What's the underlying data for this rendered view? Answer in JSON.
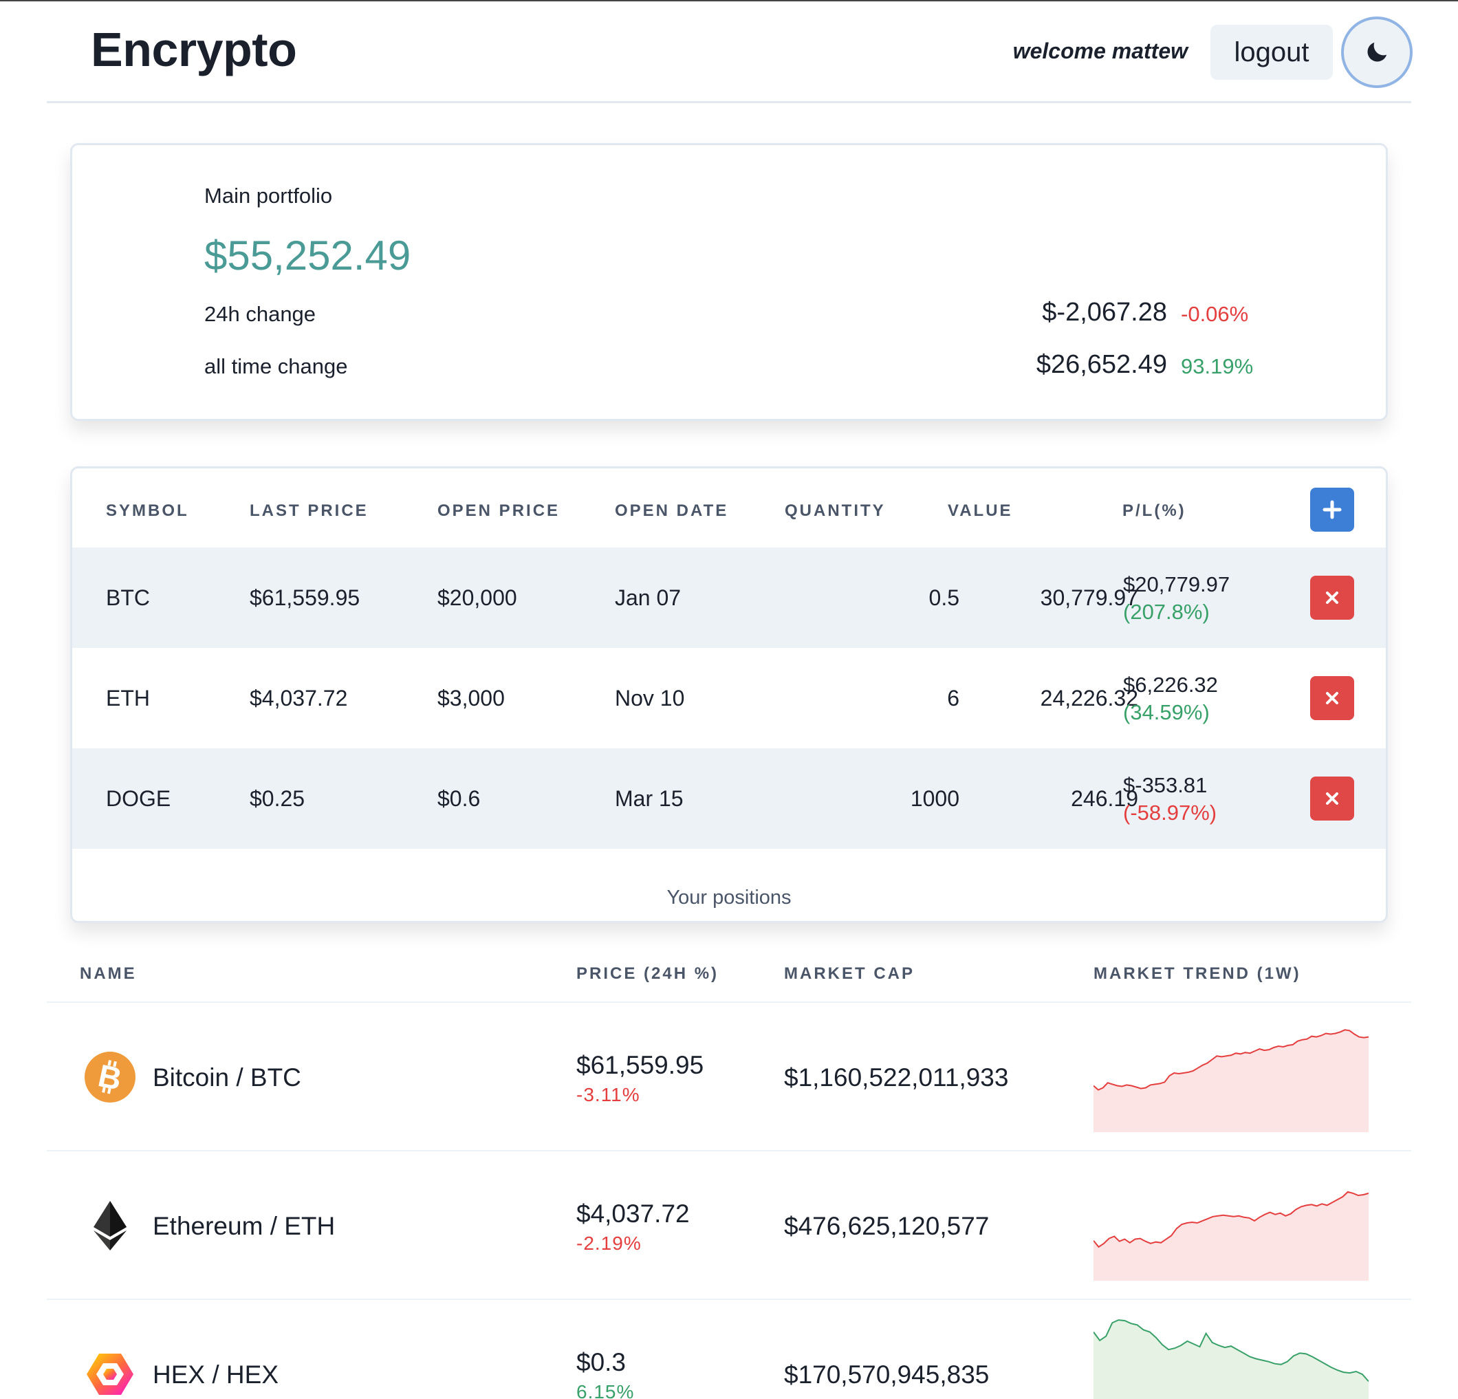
{
  "header": {
    "brand": "Encrypto",
    "welcome": "welcome mattew",
    "logout_label": "logout",
    "theme_icon": "moon-icon"
  },
  "portfolio": {
    "title": "Main portfolio",
    "total": "$55,252.49",
    "change_24h": {
      "label": "24h change",
      "amount": "$-2,067.28",
      "percent": "-0.06%",
      "direction": "down"
    },
    "change_all": {
      "label": "all time change",
      "amount": "$26,652.49",
      "percent": "93.19%",
      "direction": "up"
    }
  },
  "positions": {
    "columns": [
      "SYMBOL",
      "LAST PRICE",
      "OPEN PRICE",
      "OPEN DATE",
      "QUANTITY",
      "VALUE",
      "P/L(%)"
    ],
    "add_icon": "plus-icon",
    "delete_icon": "close-icon",
    "rows": [
      {
        "symbol": "BTC",
        "last_price": "$61,559.95",
        "open_price": "$20,000",
        "open_date": "Jan 07",
        "quantity": "0.5",
        "value": "30,779.97",
        "pl_amount": "$20,779.97",
        "pl_percent": "(207.8%)",
        "direction": "up"
      },
      {
        "symbol": "ETH",
        "last_price": "$4,037.72",
        "open_price": "$3,000",
        "open_date": "Nov 10",
        "quantity": "6",
        "value": "24,226.32",
        "pl_amount": "$6,226.32",
        "pl_percent": "(34.59%)",
        "direction": "up"
      },
      {
        "symbol": "DOGE",
        "last_price": "$0.25",
        "open_price": "$0.6",
        "open_date": "Mar 15",
        "quantity": "1000",
        "value": "246.19",
        "pl_amount": "$-353.81",
        "pl_percent": "(-58.97%)",
        "direction": "down"
      }
    ],
    "caption": "Your positions"
  },
  "market": {
    "columns": [
      "NAME",
      "PRICE (24H %)",
      "MARKET CAP",
      "MARKET TREND (1W)"
    ],
    "rows": [
      {
        "name": "Bitcoin / BTC",
        "icon": "bitcoin-icon",
        "price": "$61,559.95",
        "change": "-3.11%",
        "direction": "down",
        "market_cap": "$1,160,522,011,933",
        "trend": [
          58,
          52,
          55,
          62,
          60,
          58,
          57,
          59,
          58,
          56,
          54,
          55,
          59,
          60,
          61,
          63,
          72,
          76,
          75,
          76,
          77,
          79,
          83,
          87,
          90,
          95,
          100,
          99,
          100,
          101,
          104,
          103,
          105,
          104,
          107,
          110,
          108,
          109,
          112,
          114,
          113,
          115,
          116,
          121,
          123,
          124,
          128,
          127,
          129,
          132,
          131,
          132,
          134,
          137,
          136,
          131,
          127,
          126,
          127
        ]
      },
      {
        "name": "Ethereum / ETH",
        "icon": "ethereum-icon",
        "price": "$4,037.72",
        "change": "-2.19%",
        "direction": "down",
        "market_cap": "$476,625,120,577",
        "trend": [
          49,
          40,
          45,
          52,
          55,
          48,
          51,
          46,
          51,
          52,
          48,
          45,
          47,
          46,
          51,
          56,
          66,
          72,
          74,
          75,
          74,
          77,
          80,
          83,
          84,
          85,
          84,
          83,
          84,
          82,
          81,
          77,
          82,
          86,
          89,
          86,
          88,
          84,
          87,
          93,
          97,
          99,
          100,
          98,
          101,
          99,
          103,
          107,
          111,
          118,
          116,
          113,
          114,
          116
        ]
      },
      {
        "name": "HEX / HEX",
        "icon": "hex-icon",
        "price": "$0.3",
        "change": "6.15%",
        "direction": "up",
        "market_cap": "$170,570,945,835",
        "trend": [
          130,
          118,
          124,
          143,
          147,
          146,
          142,
          140,
          133,
          130,
          122,
          112,
          105,
          107,
          111,
          117,
          113,
          109,
          128,
          115,
          111,
          108,
          110,
          105,
          100,
          95,
          92,
          90,
          88,
          85,
          84,
          88,
          96,
          100,
          99,
          95,
          90,
          85,
          80,
          76,
          73,
          72,
          74,
          70,
          60
        ]
      }
    ]
  },
  "colors": {
    "accent": "#4a9a96",
    "negative": "#e53e3e",
    "positive": "#38a169",
    "add_button": "#3d7fd6",
    "delete_button": "#e04848"
  }
}
